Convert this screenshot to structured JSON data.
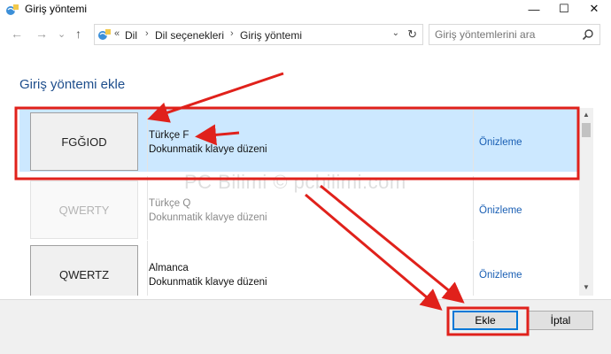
{
  "window": {
    "title": "Giriş yöntemi",
    "minimize": "—",
    "maximize": "☐",
    "close": "✕"
  },
  "nav": {
    "back": "←",
    "forward": "→",
    "recent": "⌄",
    "up": "↑"
  },
  "address": {
    "overflow": "«",
    "crumbs": [
      "Dil",
      "Dil seçenekleri",
      "Giriş yöntemi"
    ],
    "separator": "›",
    "dropdown": "⌄",
    "refresh": "↻"
  },
  "search": {
    "placeholder": "Giriş yöntemlerini ara"
  },
  "heading": "Giriş yöntemi ekle",
  "methods": [
    {
      "keyboard": "FGĞIOD",
      "name": "Türkçe F",
      "description": "Dokunmatik klavye düzeni",
      "preview": "Önizleme",
      "selected": true
    },
    {
      "keyboard": "QWERTY",
      "name": "Türkçe Q",
      "description": "Dokunmatik klavye düzeni",
      "preview": "Önizleme",
      "selected": false
    },
    {
      "keyboard": "QWERTZ",
      "name": "Almanca",
      "description": "Dokunmatik klavye düzeni",
      "preview": "Önizleme",
      "selected": false
    }
  ],
  "scroll": {
    "up": "▲",
    "down": "▼"
  },
  "buttons": {
    "add": "Ekle",
    "cancel": "İptal"
  },
  "watermark": "PC Bilimi © pcbilimi.com",
  "colors": {
    "highlight_red": "#e0211b",
    "selection_blue": "#cce8ff",
    "link_blue": "#1a5fb4",
    "heading_blue": "#1e4e8c"
  }
}
